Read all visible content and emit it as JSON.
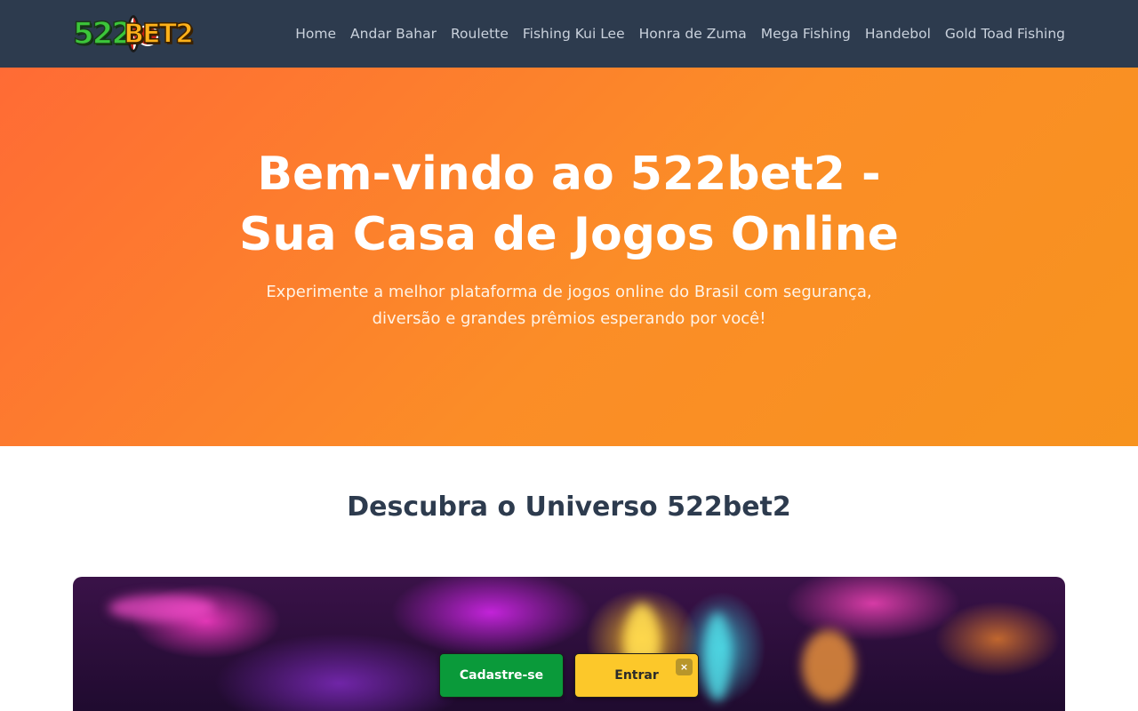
{
  "header": {
    "logo": {
      "digits": "522",
      "word": "BET2",
      "colors": {
        "digits": "#3cc63a",
        "word": "#ffb21a",
        "chip": "#d9261c"
      }
    },
    "nav": [
      {
        "label": "Home"
      },
      {
        "label": "Andar Bahar"
      },
      {
        "label": "Roulette"
      },
      {
        "label": "Fishing Kui Lee"
      },
      {
        "label": "Honra de Zuma"
      },
      {
        "label": "Mega Fishing"
      },
      {
        "label": "Handebol"
      },
      {
        "label": "Gold Toad Fishing"
      }
    ]
  },
  "hero": {
    "title_line1": "Bem-vindo ao 522bet2 -",
    "title_line2": "Sua Casa de Jogos Online",
    "subtitle": "Experimente a melhor plataforma de jogos online do Brasil com segurança, diversão e grandes prêmios esperando por você!",
    "colors": {
      "gradient_start": "#ff6b35",
      "gradient_end": "#f7931e"
    }
  },
  "section": {
    "title": "Descubra o Universo 522bet2"
  },
  "floating_actions": {
    "register_label": "Cadastre-se",
    "login_label": "Entrar",
    "close_icon": "close-icon",
    "close_glyph": "×",
    "colors": {
      "register": "#0a9a3a",
      "login": "#fcc82a"
    }
  },
  "colors": {
    "navbar": "#2d3b4e",
    "section_title": "#2d3b4e"
  }
}
